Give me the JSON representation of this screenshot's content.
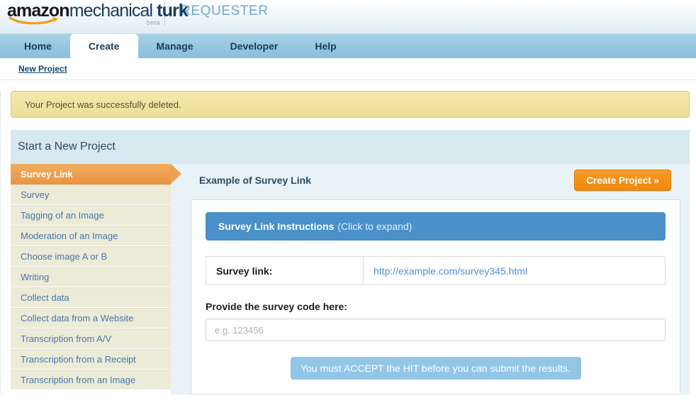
{
  "masthead": {
    "logo_amazon": "amazon",
    "logo_mechanical": "mechanical",
    "logo_turk": " turk",
    "logo_beta": "beta",
    "requester_label": "REQUESTER"
  },
  "tabs": [
    {
      "label": "Home",
      "active": false
    },
    {
      "label": "Create",
      "active": true
    },
    {
      "label": "Manage",
      "active": false
    },
    {
      "label": "Developer",
      "active": false
    },
    {
      "label": "Help",
      "active": false
    }
  ],
  "breadcrumb": {
    "label": "New Project"
  },
  "alert": {
    "message": "Your Project was successfully deleted."
  },
  "panel": {
    "title": "Start a New Project"
  },
  "sidebar": {
    "items": [
      {
        "label": "Survey Link",
        "active": true
      },
      {
        "label": "Survey",
        "active": false
      },
      {
        "label": "Tagging of an Image",
        "active": false
      },
      {
        "label": "Moderation of an Image",
        "active": false
      },
      {
        "label": "Choose image A or B",
        "active": false
      },
      {
        "label": "Writing",
        "active": false
      },
      {
        "label": "Collect data",
        "active": false
      },
      {
        "label": "Collect data from a Website",
        "active": false
      },
      {
        "label": "Transcription from A/V",
        "active": false
      },
      {
        "label": "Transcription from a Receipt",
        "active": false
      },
      {
        "label": "Transcription from an Image",
        "active": false
      }
    ]
  },
  "content": {
    "example_title": "Example of Survey Link",
    "create_button": "Create Project »",
    "instructions_title": "Survey Link Instructions",
    "instructions_hint": "(Click to expand)",
    "survey_link_label": "Survey link:",
    "survey_link_url": "http://example.com/survey345.html",
    "survey_code_label": "Provide the survey code here:",
    "survey_code_value": "",
    "survey_code_placeholder": "e.g. 123456",
    "accept_note": "You must ACCEPT the HIT before you can submit the results."
  },
  "colors": {
    "accent_orange": "#ef8a10",
    "tab_blue": "#95c6dd",
    "instr_blue": "#4a90c9",
    "alert_yellow": "#f0de98",
    "sidebar_beige": "#ecebd8"
  }
}
